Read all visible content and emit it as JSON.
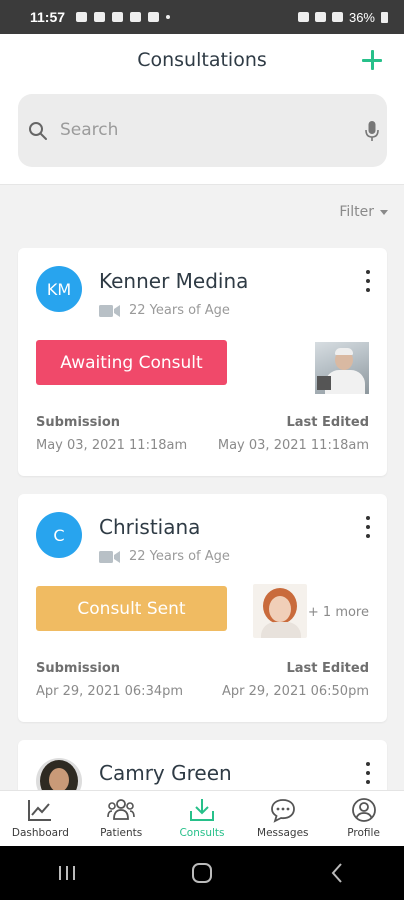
{
  "status_bar": {
    "time": "11:57",
    "battery": "36%"
  },
  "header": {
    "title": "Consultations"
  },
  "search": {
    "placeholder": "Search"
  },
  "filter": {
    "label": "Filter"
  },
  "cards": [
    {
      "initials": "KM",
      "name": "Kenner Medina",
      "age": "22 Years of Age",
      "status": "Awaiting Consult",
      "status_color": "#f0496a",
      "submission_label": "Submission",
      "submission_date": "May 03, 2021 11:18am",
      "edited_label": "Last Edited",
      "edited_date": "May 03, 2021 11:18am"
    },
    {
      "initials": "C",
      "name": "Christiana",
      "age": "22 Years of Age",
      "status": "Consult Sent",
      "status_color": "#f0bb62",
      "more": "+ 1 more",
      "submission_label": "Submission",
      "submission_date": "Apr 29, 2021 06:34pm",
      "edited_label": "Last Edited",
      "edited_date": "Apr 29, 2021 06:50pm"
    },
    {
      "name": "Camry Green"
    }
  ],
  "nav": [
    {
      "label": "Dashboard",
      "icon": "chart-icon"
    },
    {
      "label": "Patients",
      "icon": "people-icon"
    },
    {
      "label": "Consults",
      "icon": "download-icon",
      "active": true
    },
    {
      "label": "Messages",
      "icon": "chat-icon"
    },
    {
      "label": "Profile",
      "icon": "user-icon"
    }
  ],
  "colors": {
    "accent": "#27c08a",
    "avatar_blue": "#28a4ee"
  }
}
